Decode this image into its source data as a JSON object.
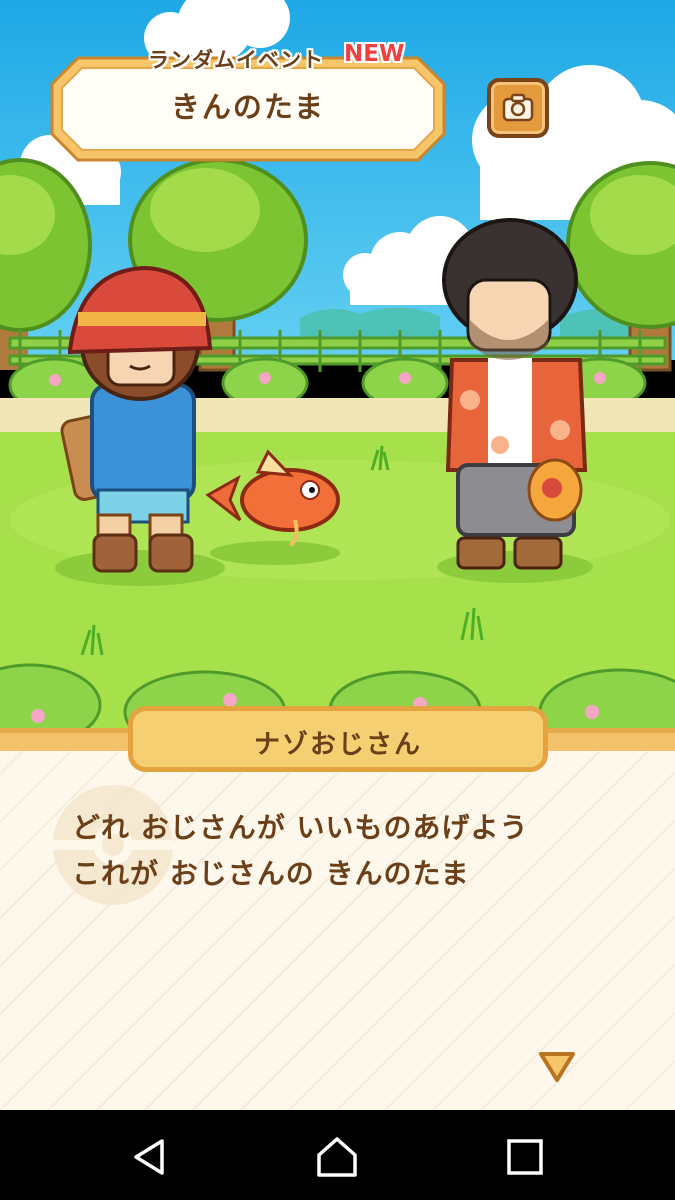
{
  "event": {
    "kicker": "ランダムイベント",
    "badge": "NEW",
    "title": "きんのたま"
  },
  "camera_button": {
    "icon": "camera-icon"
  },
  "dialog": {
    "speaker": "ナゾおじさん",
    "lines": [
      "どれ おじさんが いいものあげよう",
      "これが おじさんの きんのたま"
    ],
    "advance_icon": "triangle-down-icon"
  },
  "navbar": {
    "buttons": [
      "back-icon",
      "home-icon",
      "recent-apps-icon"
    ]
  },
  "colors": {
    "sky": "#2fb3e8",
    "grass": "#a6e04a",
    "banner_border": "#e3a64b",
    "text_brown": "#6b3f17",
    "new_red": "#ef4140",
    "dialog_bg": "#fdf7ec",
    "speaker_plate": "#f6cf72"
  }
}
